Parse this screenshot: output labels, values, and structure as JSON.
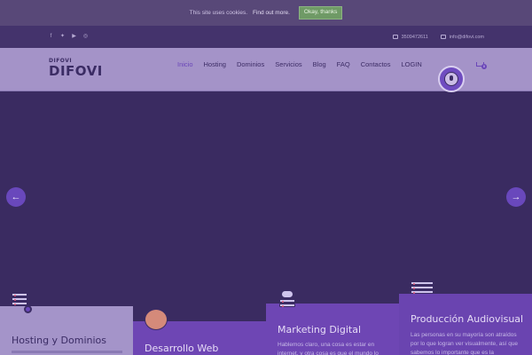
{
  "cookie": {
    "message": "This site uses cookies.",
    "link": "Find out more.",
    "button": "Okay, thanks"
  },
  "topbar": {
    "social": [
      "facebook-icon",
      "twitter-icon",
      "youtube-icon",
      "instagram-icon"
    ],
    "phone": "3509472611",
    "email": "info@difovi.com"
  },
  "header": {
    "logo_small": "DIFOVI",
    "logo_big": "DIFOVI",
    "nav": [
      "Inicio",
      "Hosting",
      "Dominios",
      "Servicios",
      "Blog",
      "FAQ",
      "Contactos",
      "LOGIN"
    ],
    "active_nav": "Inicio",
    "cart_count": "0"
  },
  "slider": {
    "prev": "←",
    "next": "→"
  },
  "services": [
    {
      "title": "Hosting y Dominios",
      "text": ""
    },
    {
      "title": "Desarrollo Web",
      "text": ""
    },
    {
      "title": "Marketing Digital",
      "text": "Hablemos claro, una cosa es estar en internet, y otra cosa es que el mundo lo"
    },
    {
      "title": "Producción Audiovisual",
      "text": "Las personas en su mayoría son atraídos por lo que logran ver visualmente, así que sabemos lo importante que es la"
    }
  ],
  "colors": {
    "brand_purple": "#6a46b8",
    "header_bg": "#a493c8",
    "topbar_bg": "#44336c",
    "hero_bg": "#3a2b61",
    "accept_button": "#6f9a66"
  }
}
